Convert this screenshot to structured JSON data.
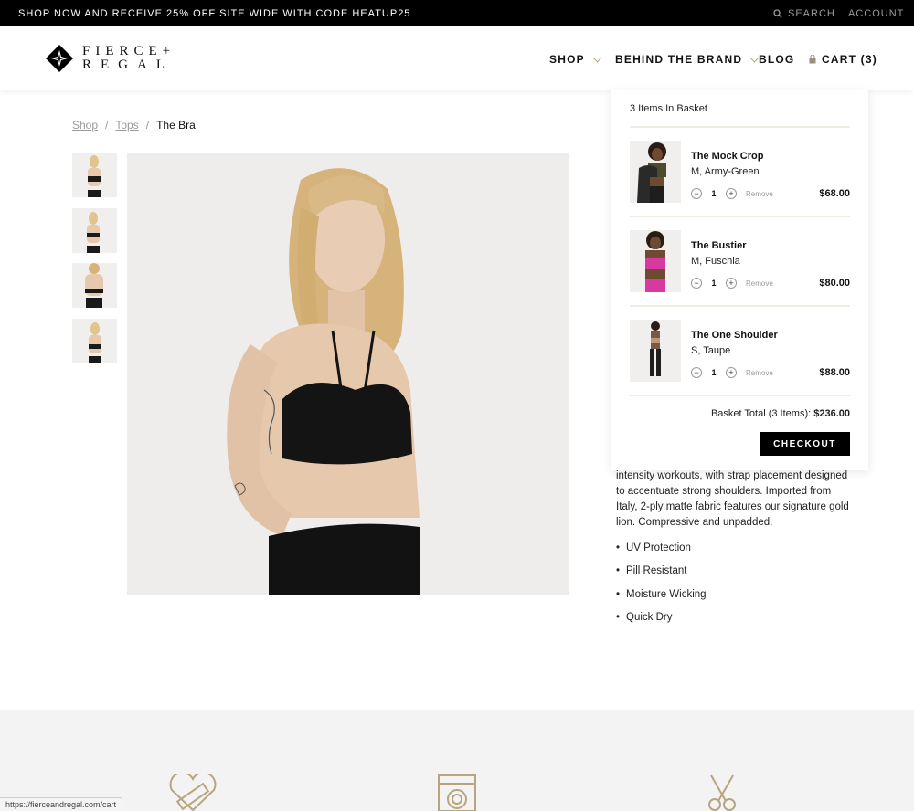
{
  "promo": {
    "message": "SHOP NOW AND RECEIVE 25% OFF SITE WIDE WITH CODE HEATUP25",
    "search": "SEARCH",
    "account": "ACCOUNT"
  },
  "brand": {
    "line1": "FIERCE+",
    "line2": "REGAL"
  },
  "nav": {
    "shop": "SHOP",
    "brand": "BEHIND THE BRAND",
    "blog": "BLOG",
    "cart": "CART (3)"
  },
  "breadcrumb": {
    "shop": "Shop",
    "tops": "Tops",
    "current": "The Bra",
    "sep": "/"
  },
  "description": "intensity workouts, with strap placement designed to accentuate strong shoulders. Imported from Italy, 2-ply matte fabric features our signature gold lion. Compressive and unpadded.",
  "features": [
    "UV Protection",
    "Pill Resistant",
    "Moisture Wicking",
    "Quick Dry"
  ],
  "cart": {
    "heading": "3 Items In Basket",
    "items": [
      {
        "name": "The Mock Crop",
        "variant": "M, Army-Green",
        "qty": "1",
        "price": "$68.00",
        "remove": "Remove"
      },
      {
        "name": "The Bustier",
        "variant": "M, Fuschia",
        "qty": "1",
        "price": "$80.00",
        "remove": "Remove"
      },
      {
        "name": "The One Shoulder",
        "variant": "S, Taupe",
        "qty": "1",
        "price": "$88.00",
        "remove": "Remove"
      }
    ],
    "total_label": "Basket Total (3 Items):",
    "total_value": "$236.00",
    "checkout": "CHECKOUT"
  },
  "status_url": "https://fierceandregal.com/cart",
  "colors": {
    "accent": "#b7a57f",
    "black": "#000000",
    "band": "#f3f3f3"
  }
}
